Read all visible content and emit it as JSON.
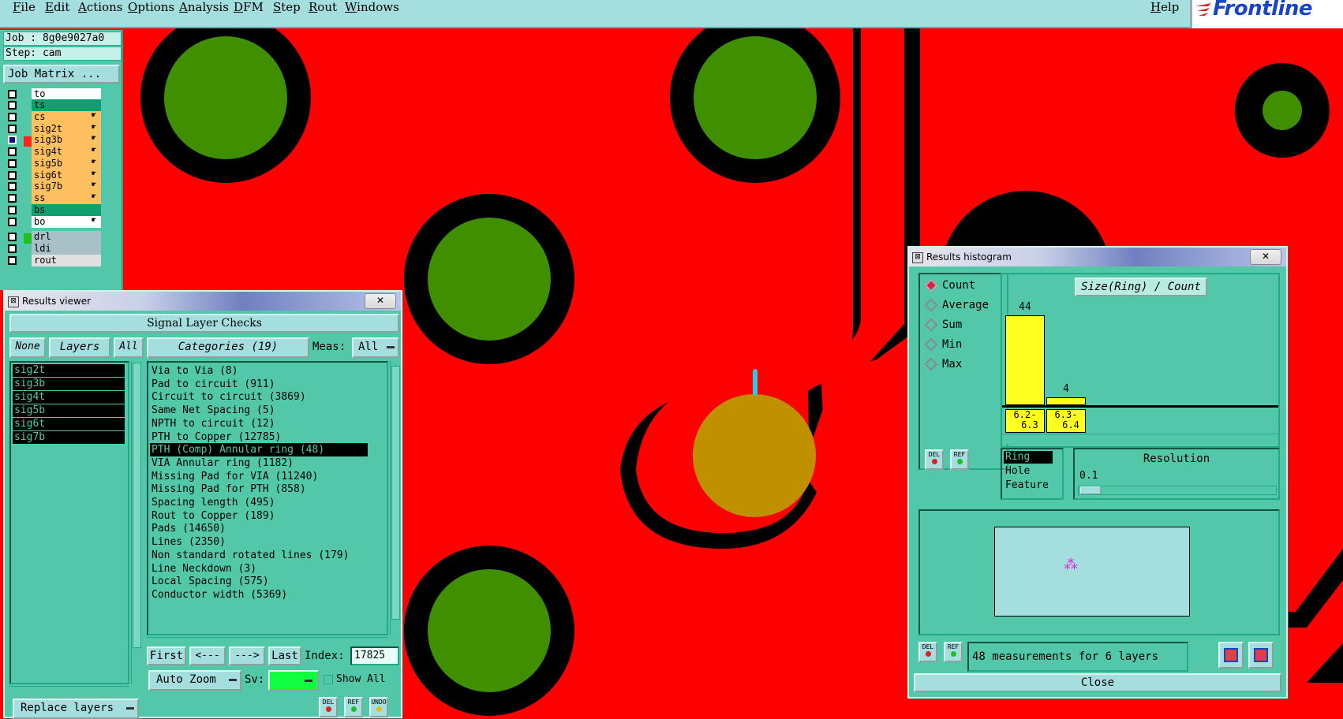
{
  "menu": {
    "items": [
      "File",
      "Edit",
      "Actions",
      "Options",
      "Analysis",
      "DFM",
      "Step",
      "Rout",
      "Windows"
    ],
    "help": "Help",
    "logo": "Frontline"
  },
  "job": {
    "job_line": "Job : 8g0e9027a0",
    "step_line": "Step: cam",
    "matrix_button": "Job Matrix ..."
  },
  "layers": [
    {
      "name": "to",
      "color": "#ffffff",
      "hand": ""
    },
    {
      "name": "ts",
      "color": "#10a070",
      "hand": ""
    },
    {
      "name": "cs",
      "color": "#ffc060",
      "hand": "☛"
    },
    {
      "name": "sig2t",
      "color": "#ffc060",
      "hand": "☛"
    },
    {
      "name": "sig3b",
      "color": "#ffc060",
      "hand": "☛"
    },
    {
      "name": "sig4t",
      "color": "#ffc060",
      "hand": "☛"
    },
    {
      "name": "sig5b",
      "color": "#ffc060",
      "hand": "☛"
    },
    {
      "name": "sig6t",
      "color": "#ffc060",
      "hand": "☛"
    },
    {
      "name": "sig7b",
      "color": "#ffc060",
      "hand": "☛"
    },
    {
      "name": "ss",
      "color": "#ffc060",
      "hand": "☛"
    },
    {
      "name": "bs",
      "color": "#10a070",
      "hand": ""
    },
    {
      "name": "bo",
      "color": "#ffffff",
      "hand": "☛"
    },
    {
      "name": "drl",
      "color": "#a8c0c8",
      "hand": ""
    },
    {
      "name": "ldi",
      "color": "#a8c0c8",
      "hand": ""
    },
    {
      "name": "rout",
      "color": "#e0e0e0",
      "hand": ""
    }
  ],
  "results_viewer": {
    "title": "Results viewer",
    "close": "✕",
    "header": "Signal Layer Checks",
    "none_btn": "None",
    "layers_label": "Layers",
    "all_btn": "All",
    "categories_label": "Categories (19)",
    "meas_label": "Meas:",
    "meas_value": "All",
    "layer_list": [
      "sig2t",
      "sig3b",
      "sig4t",
      "sig5b",
      "sig6t",
      "sig7b"
    ],
    "categories": [
      "Via to Via (8)",
      "Pad to circuit (911)",
      "Circuit to circuit (3869)",
      "Same Net Spacing (5)",
      "NPTH to circuit (12)",
      "PTH to Copper (12785)",
      "PTH (Comp) Annular ring (48)",
      "VIA Annular ring (1182)",
      "Missing Pad for VIA (11240)",
      "Missing Pad for PTH (858)",
      "Spacing length (495)",
      "Rout to Copper (189)",
      "Pads (14650)",
      "Lines (2350)",
      "Non standard rotated lines (179)",
      "Line Neckdown (3)",
      "Local Spacing (575)",
      "Conductor width (5369)"
    ],
    "selected_category_index": 6,
    "first_btn": "First",
    "prev_btn": "<---",
    "next_btn": "--->",
    "last_btn": "Last",
    "index_label": "Index:",
    "index_value": "17825",
    "auto_zoom": "Auto Zoom",
    "sv_label": "Sv:",
    "show_all": "Show All",
    "replace_layers": "Replace layers",
    "del": "DEL",
    "ref": "REF",
    "undo": "UNDO"
  },
  "histogram": {
    "title": "Results histogram",
    "close": "✕",
    "modes": [
      "Count",
      "Average",
      "Sum",
      "Min",
      "Max"
    ],
    "selected_mode": "Count",
    "chart_title": "Size(Ring) / Count",
    "bins": [
      {
        "label_top": "6.2-",
        "label_bottom": "6.3",
        "count": 44
      },
      {
        "label_top": "6.3-",
        "label_bottom": "6.4",
        "count": 4
      }
    ],
    "max_count": 44,
    "props": [
      "Ring",
      "Hole",
      "Feature"
    ],
    "selected_prop": "Ring",
    "resolution_label": "Resolution",
    "resolution_value": "0.1",
    "status": "48 measurements for 6 layers",
    "close_btn": "Close",
    "del": "DEL",
    "ref": "REF"
  }
}
